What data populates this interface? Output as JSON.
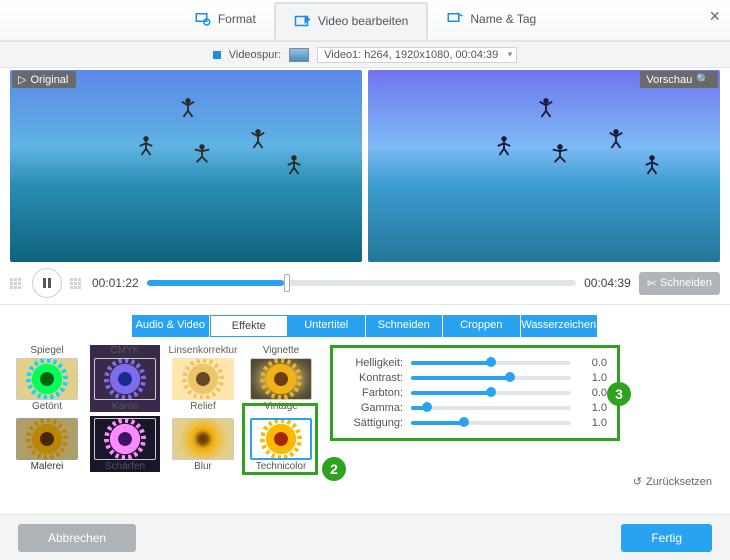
{
  "icons": {
    "scissors": "scissors-icon",
    "magnify": "magnify-icon",
    "reset": "reset-icon",
    "play_tri": "play-triangle-icon"
  },
  "toptabs": {
    "format": "Format",
    "edit": "Video bearbeiten",
    "nametag": "Name & Tag"
  },
  "track": {
    "label": "Videospur:",
    "info": "Video1: h264, 1920x1080, 00:04:39"
  },
  "preview": {
    "original": "Original",
    "vorschau": "Vorschau"
  },
  "timeline": {
    "current": "00:01:22",
    "total": "00:04:39",
    "cut": "Schneiden"
  },
  "subtabs": {
    "av": "Audio & Video",
    "effects": "Effekte",
    "sub": "Untertitel",
    "cut": "Schneiden",
    "crop": "Croppen",
    "water": "Wasserzeichen"
  },
  "effects": {
    "row1": [
      "Spiegel",
      "CMYK",
      "Linsenkorrektur",
      "Vignette"
    ],
    "row2": [
      "Getönt",
      "Kante",
      "Relief",
      "Vintage"
    ],
    "row3": [
      "Malerei",
      "Schärfen",
      "Blur",
      "Technicolor"
    ]
  },
  "sliders": {
    "brightness": {
      "label": "Helligkeit:",
      "value": "0.0",
      "pct": 50
    },
    "contrast": {
      "label": "Kontrast:",
      "value": "1.0",
      "pct": 62
    },
    "hue": {
      "label": "Farbton:",
      "value": "0.0",
      "pct": 50
    },
    "gamma": {
      "label": "Gamma:",
      "value": "1.0",
      "pct": 10
    },
    "saturation": {
      "label": "Sättigung:",
      "value": "1.0",
      "pct": 33
    }
  },
  "reset_label": "Zurücksetzen",
  "callouts": {
    "two": "2",
    "three": "3"
  },
  "footer": {
    "cancel": "Abbrechen",
    "done": "Fertig"
  }
}
